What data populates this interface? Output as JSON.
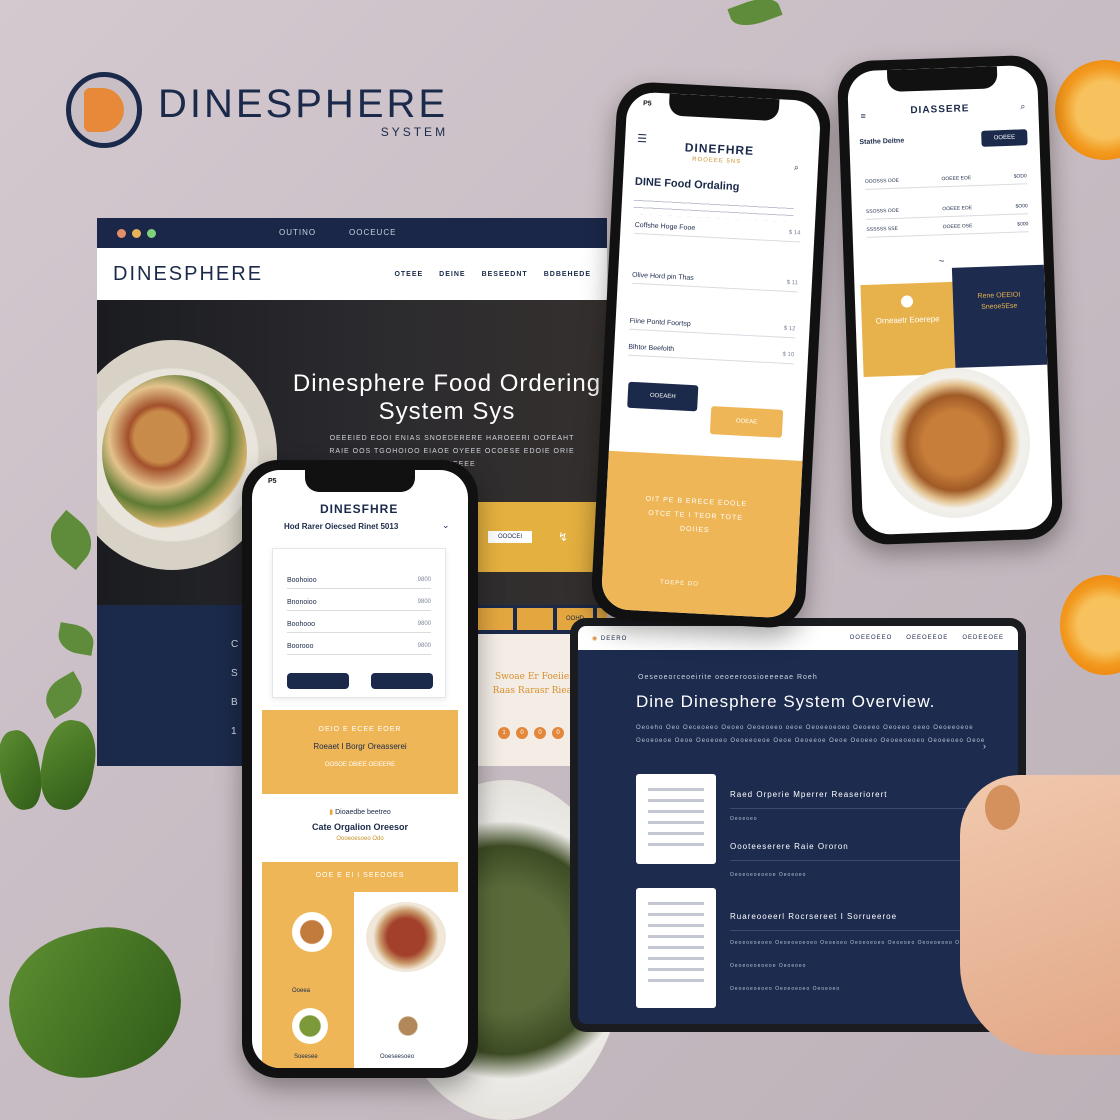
{
  "brand": {
    "name": "DINESPHERE",
    "sub": "SYSTEM"
  },
  "desktop": {
    "bar_links": [
      "OUTINO",
      "OOCEUCE"
    ],
    "logo": "DINESPHERE",
    "nav_links": [
      "OTEEE",
      "DEINE",
      "BESEEDNT",
      "BDBEHEDE"
    ],
    "hero_title": "Dinesphere Food Ordering System Sys",
    "hero_sub": "OEEEIED EOOI ENIAS SNOEDERERE HAROEERI OOFEAHT RAIE OOS TGOHOIOO EIAOE OYEEE OCOESE EDOIE ORIE OODEEEEE",
    "strip_labels": [
      "",
      "",
      "OOHD",
      ""
    ],
    "side_text": "Swoae Er Foeiien Raas Rarasr Rieae",
    "side_circles": [
      "1",
      "0",
      "0",
      "0"
    ],
    "left_letters": [
      "C",
      "S",
      "B",
      "1"
    ],
    "cta_label": "OOOCEI"
  },
  "phone_center": {
    "status": "P5",
    "logo": "DINEFHRE",
    "logo_sub": "ROOEEE 5NS",
    "title": "DINE Food Ordaling",
    "sections": [
      {
        "label": "Coffshe Hoge Fooe",
        "price": "$ 14"
      },
      {
        "label": "Olive Hord pin Thas",
        "price": "$ 11"
      },
      {
        "label": "Fiine Pontd Foortsp",
        "price": "$ 12"
      },
      {
        "label": "Blhtor Beefolth",
        "price": "$ 10"
      }
    ],
    "btn_navy": "OOEAEH",
    "btn_gold": "OOEAE",
    "promo": "OIT PE B ERECE EOOLE OTCE TE I TEOR TOTE DOIIES",
    "promo_btn": "TOEPE DO"
  },
  "phone_right": {
    "logo": "DIASSERE",
    "title": "Stathe Deitne",
    "btn": "OOEEE",
    "rows": [
      {
        "a": "OOOSSS OOE",
        "b": "OOEEE EOE",
        "p": "$OD0"
      },
      {
        "a": "SSOSSS OOE",
        "b": "OOEEE EOE",
        "p": "$O00"
      },
      {
        "a": "SSSSSS SSE",
        "b": "OOEEE OSE",
        "p": "$000"
      }
    ],
    "card_gold": "Orneaetr Eoerepe",
    "card_navy": "Rene OEEIOI Sneoe5Ese"
  },
  "phone_left": {
    "status": "P5",
    "logo": "DINESFHRE",
    "title": "Hod Rarer Oiecsed Rinet 5013",
    "rows": [
      {
        "name": "Boohoioo",
        "price": "9800"
      },
      {
        "name": "Bnonoioo",
        "price": "9800"
      },
      {
        "name": "Boohooo",
        "price": "9800"
      },
      {
        "name": "Boorooo",
        "price": "9800"
      }
    ],
    "btn_a": "",
    "btn_b": "",
    "promo_sub": "OEIO E ECEE EOER",
    "promo_title": "Roeaet I Borgr Oreasserei",
    "promo_foot": "OOSOE OBIEE OEIEERE",
    "cat_pre": "Dioaedbe beetreo",
    "cat_title": "Cate Orgalion Oreesor",
    "cat_link": "Oooeoesoeo Odo",
    "gold_head": "OOE E EI I SEEOOES",
    "cap1": "Ooeea",
    "cap2": "Soeesee",
    "cap3": "Ooeseesoeo"
  },
  "tablet": {
    "top_left": "DEERO",
    "top_links": [
      "OOEEOEEO",
      "OEEOEEOE",
      "OEDEEOEE"
    ],
    "pre": "Oeseoeorceoeirite oeoeeroosioeeeeae Roeh",
    "title": "Dine Dinesphere System Overview.",
    "desc": "Oeoeho Oeo Oeceoeeo Oeoeo Oeoeoeeo oeoe Oeoeeoeoeo Oeoeeo Oeoeeo oeeo Oeoeeoeoe Oeoeoeoe Oeoe Oeoeoeo Oeoeeoeoe Oeoe Oeoeeoe Oeoe Oeoeeo Oeoeeoeoeo Oeoeeoeo Oeoe",
    "items": [
      "Raed Orperie Mperrer Reaseriorert",
      "Oooteeserere Raie Ororon",
      "Ruareooeerl Rocrsereet I Sorrueeroe"
    ],
    "small": [
      "Oeoeoeo",
      "Oeoeoeoeoeoe Oeoeoeo",
      "Oeoeoeoeoeo Oeoeoeoeoeo Oeoeoeo Oeoeoeoeo Oeoeoeo Oeoeoeoeo Oeoeoeo",
      "Oeoeoeoeoeoe Oeoeoeo",
      "Oeoeoeoeoeo Oeoeoeoeo Oeoeoeo"
    ]
  },
  "colors": {
    "navy": "#1b2a4a",
    "gold": "#e4b03f",
    "orange": "#e8893a",
    "bg": "#c9bec4"
  }
}
